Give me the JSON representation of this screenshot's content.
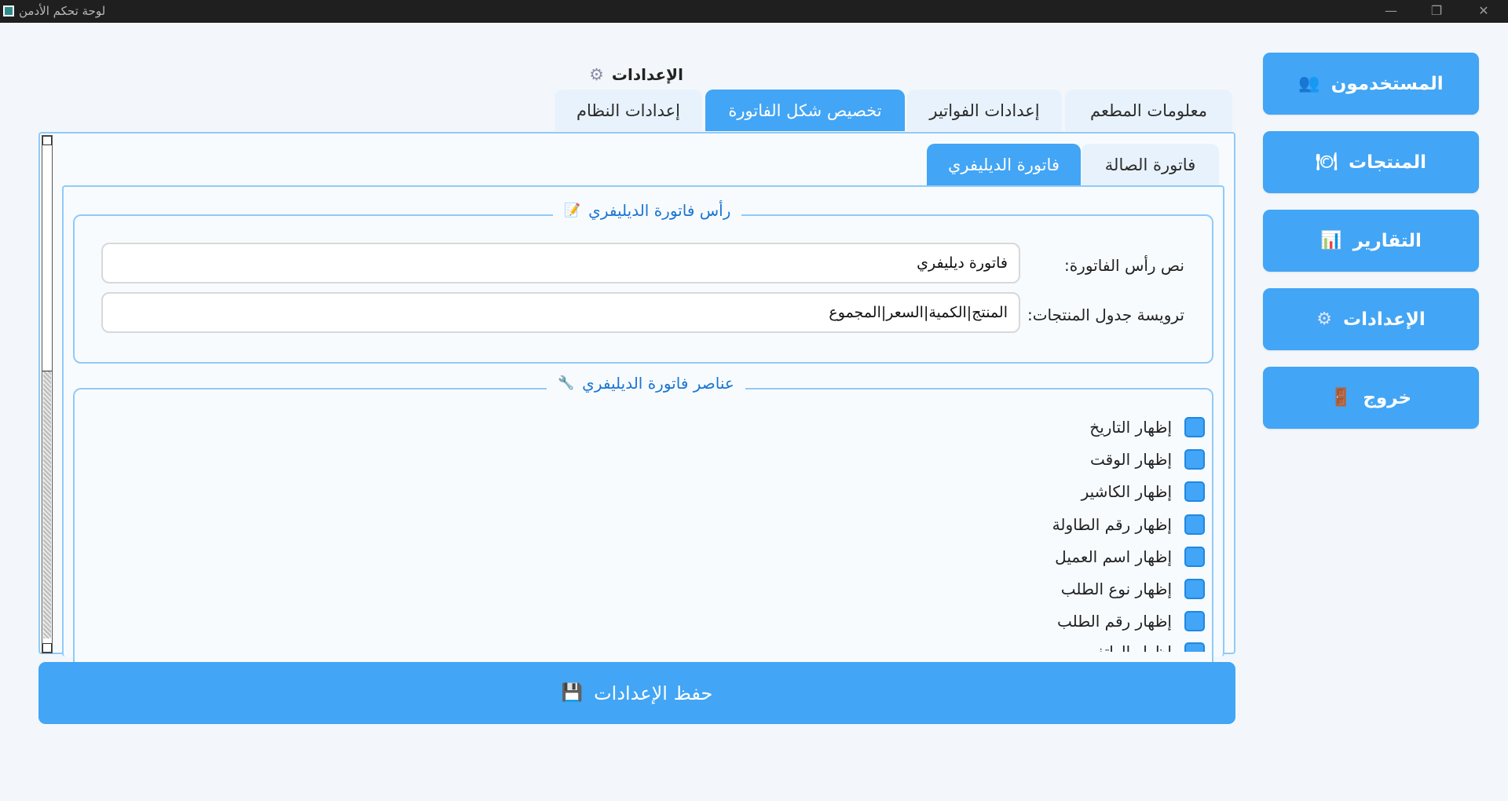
{
  "window": {
    "title": "لوحة تحكم الأدمن",
    "minimize_glyph": "—",
    "maximize_glyph": "❐",
    "close_glyph": "✕",
    "app_icon": "app-icon"
  },
  "sidebar": {
    "items": [
      {
        "label": "المستخدمون",
        "icon": "👥"
      },
      {
        "label": "المنتجات",
        "icon": "🍽"
      },
      {
        "label": "التقارير",
        "icon": "📊"
      },
      {
        "label": "الإعدادات",
        "icon": "⚙"
      },
      {
        "label": "خروج",
        "icon": "🚪"
      }
    ]
  },
  "page": {
    "title": "الإعدادات",
    "title_icon": "⚙"
  },
  "tabs": [
    {
      "label": "معلومات المطعم"
    },
    {
      "label": "إعدادات الفواتير"
    },
    {
      "label": "تخصيص شكل الفاتورة",
      "active": true
    },
    {
      "label": "إعدادات النظام"
    }
  ],
  "subtabs": [
    {
      "label": "فاتورة الصالة"
    },
    {
      "label": "فاتورة الديليفري",
      "active": true
    }
  ],
  "header_group": {
    "title": "رأس فاتورة الديليفري",
    "icon": "📝",
    "fields": [
      {
        "label": "نص رأس الفاتورة:",
        "value": "فاتورة ديليفري"
      },
      {
        "label": "ترويسة جدول المنتجات:",
        "value": "المنتج|الكمية|السعر|المجموع"
      }
    ]
  },
  "elements_group": {
    "title": "عناصر فاتورة الديليفري",
    "icon": "🔧",
    "checkboxes": [
      {
        "label": "إظهار التاريخ",
        "checked": false
      },
      {
        "label": "إظهار الوقت",
        "checked": false
      },
      {
        "label": "إظهار الكاشير",
        "checked": false
      },
      {
        "label": "إظهار رقم الطاولة",
        "checked": false
      },
      {
        "label": "إظهار اسم العميل",
        "checked": false
      },
      {
        "label": "إظهار نوع الطلب",
        "checked": false
      },
      {
        "label": "إظهار رقم الطلب",
        "checked": false
      },
      {
        "label": "إظهار الهاتف",
        "checked": false
      }
    ]
  },
  "save_button": {
    "label": "حفظ الإعدادات",
    "icon": "💾"
  },
  "colors": {
    "accent": "#42a5f5",
    "frame_border": "#90caf9",
    "legend_text": "#1976d2",
    "background": "#f3f7fb"
  }
}
